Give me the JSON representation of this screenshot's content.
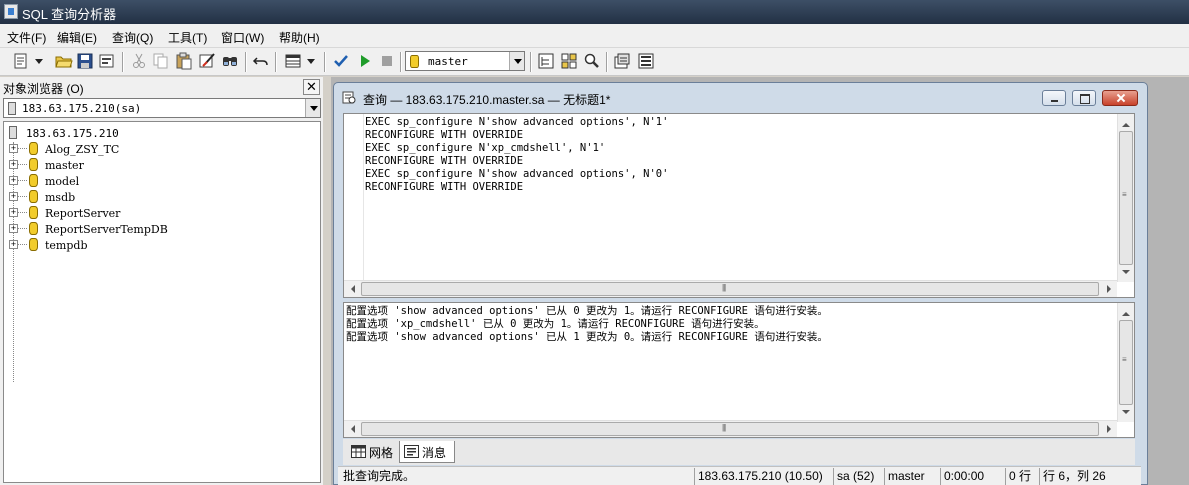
{
  "app": {
    "title": "SQL 查询分析器"
  },
  "menu": [
    "文件(F)",
    "编辑(E)",
    "查询(Q)",
    "工具(T)",
    "窗口(W)",
    "帮助(H)"
  ],
  "toolbar": {
    "database": "master",
    "icons": [
      "new-query-icon",
      "open-icon",
      "save-icon",
      "insert-template-icon",
      "cut-icon",
      "copy-icon",
      "paste-icon",
      "clear-icon",
      "find-icon",
      "undo-icon",
      "results-mode-icon",
      "parse-icon",
      "execute-icon",
      "cancel-icon",
      "object-browser-icon",
      "object-search-icon",
      "show-plan-icon",
      "properties-icon",
      "options-icon"
    ]
  },
  "object_browser": {
    "title": "对象浏览器 (O)",
    "server": "183.63.175.210(sa)",
    "root": "183.63.175.210",
    "databases": [
      "Alog_ZSY_TC",
      "master",
      "model",
      "msdb",
      "ReportServer",
      "ReportServerTempDB",
      "tempdb"
    ]
  },
  "query_window": {
    "title": "查询 — 183.63.175.210.master.sa — 无标题1*",
    "code": [
      "EXEC sp_configure N'show advanced options', N'1'",
      "RECONFIGURE WITH OVERRIDE",
      "EXEC sp_configure N'xp_cmdshell', N'1'",
      "RECONFIGURE WITH OVERRIDE",
      "EXEC sp_configure N'show advanced options', N'0'",
      "RECONFIGURE WITH OVERRIDE"
    ],
    "messages": [
      "配置选项 'show advanced options' 已从 0 更改为 1。请运行 RECONFIGURE 语句进行安装。",
      "配置选项 'xp_cmdshell' 已从 0 更改为 1。请运行 RECONFIGURE 语句进行安装。",
      "配置选项 'show advanced options' 已从 1 更改为 0。请运行 RECONFIGURE 语句进行安装。"
    ],
    "tabs": [
      "网格",
      "消息"
    ],
    "active_tab": "消息"
  },
  "status": {
    "message": "批查询完成。",
    "server": "183.63.175.210 (10.50)",
    "user": "sa (52)",
    "database": "master",
    "time": "0:00:00",
    "rows": "0 行",
    "position": "行 6，列 26"
  }
}
